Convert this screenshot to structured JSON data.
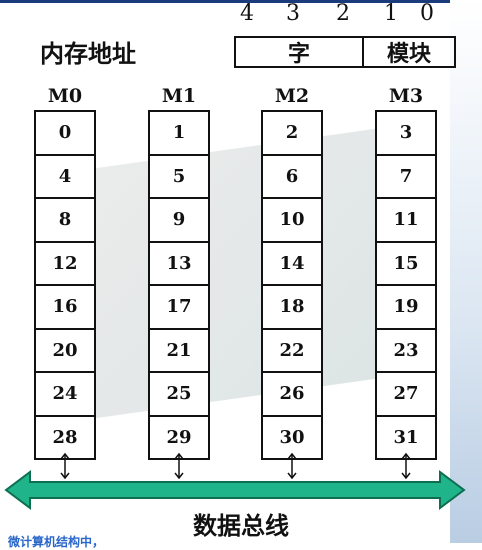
{
  "bit_numbers": [
    "4",
    "3",
    "2",
    "1",
    "0"
  ],
  "memory_address_label": "内存地址",
  "address_fields": {
    "word": "字",
    "module": "模块"
  },
  "modules": [
    {
      "name": "M0",
      "cells": [
        "0",
        "4",
        "8",
        "12",
        "16",
        "20",
        "24",
        "28"
      ]
    },
    {
      "name": "M1",
      "cells": [
        "1",
        "5",
        "9",
        "13",
        "17",
        "21",
        "25",
        "29"
      ]
    },
    {
      "name": "M2",
      "cells": [
        "2",
        "6",
        "10",
        "14",
        "18",
        "22",
        "26",
        "30"
      ]
    },
    {
      "name": "M3",
      "cells": [
        "3",
        "7",
        "11",
        "15",
        "19",
        "23",
        "27",
        "31"
      ]
    }
  ],
  "bus_label": "数据总线",
  "footnote": "微计算机结构中，",
  "colors": {
    "bus": "#20b48a",
    "bus_stroke": "#0d6e50",
    "footnote": "#2a67c9"
  }
}
